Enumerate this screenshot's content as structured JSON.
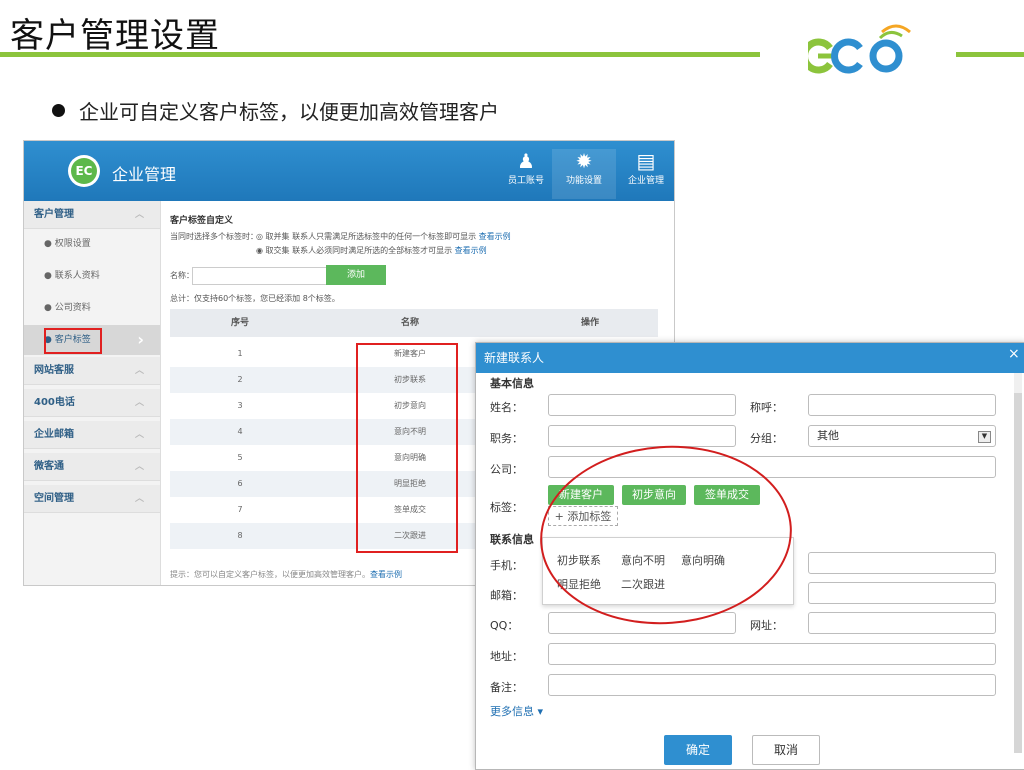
{
  "slide": {
    "title": "客户管理设置",
    "bullet": "企业可自定义客户标签，以便更加高效管理客户",
    "brand_color": "#8cc43c"
  },
  "app": {
    "title": "企业管理",
    "badge": "EC",
    "topnav": [
      {
        "label": "员工账号",
        "icon": "staff-icon"
      },
      {
        "label": "功能设置",
        "icon": "gear-icon"
      },
      {
        "label": "企业管理",
        "icon": "enterprise-icon"
      }
    ],
    "sidebar": {
      "group_customer": "客户管理",
      "items": [
        "权限设置",
        "联系人资料",
        "公司资料",
        "客户标签"
      ],
      "groups": [
        "网站客服",
        "400电话",
        "企业邮箱",
        "微客通",
        "空间管理"
      ]
    },
    "main": {
      "heading": "客户标签自定义",
      "option_label": "当同时选择多个标签时：",
      "opt1_text": "取并集 联系人只需满足所选标签中的任何一个标签即可显示",
      "opt2_text": "取交集 联系人必须同时满足所选的全部标签才可显示",
      "view_example": "查看示例",
      "name_label": "名称：",
      "add_button": "添加",
      "summary": "总计：仅支持60个标签，您已经添加 8个标签。",
      "col_no": "序号",
      "col_name": "名称",
      "col_action": "操作",
      "rows": [
        {
          "no": "1",
          "name": "新建客户"
        },
        {
          "no": "2",
          "name": "初步联系"
        },
        {
          "no": "3",
          "name": "初步意向"
        },
        {
          "no": "4",
          "name": "意向不明"
        },
        {
          "no": "5",
          "name": "意向明确"
        },
        {
          "no": "6",
          "name": "明显拒绝"
        },
        {
          "no": "7",
          "name": "签单成交"
        },
        {
          "no": "8",
          "name": "二次跟进"
        }
      ],
      "tip": "提示：您可以自定义客户标签，以便更加高效管理客户。",
      "tip_link": "查看示例"
    }
  },
  "dialog": {
    "title": "新建联系人",
    "close": "×",
    "section_basic": "基本信息",
    "name_label": "姓名：",
    "salutation_label": "称呼：",
    "position_label": "职务：",
    "group_label": "分组：",
    "group_value": "其他",
    "company_label": "公司：",
    "tags_label": "标签：",
    "selected_tags": [
      "新建客户",
      "初步意向",
      "签单成交"
    ],
    "add_tag": "+ 添加标签",
    "tag_options_row1": [
      "初步联系",
      "意向不明",
      "意向明确"
    ],
    "tag_options_row2": [
      "明显拒绝",
      "二次跟进"
    ],
    "section_contact": "联系信息",
    "mobile_label": "手机：",
    "email_label": "邮箱：",
    "qq_label": "QQ：",
    "website_label": "网址：",
    "address_label": "地址：",
    "remark_label": "备注：",
    "more_info": "更多信息 ▾",
    "ok": "确定",
    "cancel": "取消"
  }
}
